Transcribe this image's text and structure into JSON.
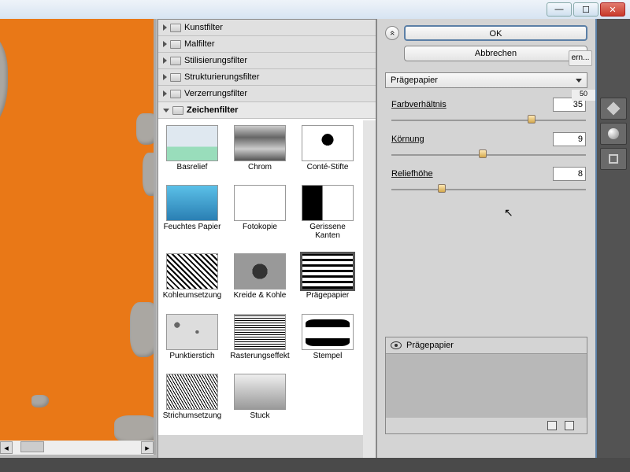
{
  "window": {
    "minimize": "—",
    "maximize": "☐",
    "close": "✕",
    "ern": "ern..."
  },
  "ruler": "50",
  "categories": [
    {
      "label": "Kunstfilter",
      "expanded": false
    },
    {
      "label": "Malfilter",
      "expanded": false
    },
    {
      "label": "Stilisierungsfilter",
      "expanded": false
    },
    {
      "label": "Strukturierungsfilter",
      "expanded": false
    },
    {
      "label": "Verzerrungsfilter",
      "expanded": false
    },
    {
      "label": "Zeichenfilter",
      "expanded": true
    }
  ],
  "filters": [
    {
      "label": "Basrelief",
      "art": "art-bas"
    },
    {
      "label": "Chrom",
      "art": "art-chr"
    },
    {
      "label": "Conté-Stifte",
      "art": "art-con"
    },
    {
      "label": "Feuchtes Papier",
      "art": "art-feu"
    },
    {
      "label": "Fotokopie",
      "art": "art-fot"
    },
    {
      "label": "Gerissene Kanten",
      "art": "art-ger"
    },
    {
      "label": "Kohleumsetzung",
      "art": "art-koh"
    },
    {
      "label": "Kreide & Kohle",
      "art": "art-kre"
    },
    {
      "label": "Prägepapier",
      "art": "art-pra",
      "selected": true
    },
    {
      "label": "Punktierstich",
      "art": "art-pun"
    },
    {
      "label": "Rasterungseffekt",
      "art": "art-ras"
    },
    {
      "label": "Stempel",
      "art": "art-ste"
    },
    {
      "label": "Strichumsetzung",
      "art": "art-str"
    },
    {
      "label": "Stuck",
      "art": "art-stu"
    }
  ],
  "buttons": {
    "ok": "OK",
    "cancel": "Abbrechen",
    "collapse": "«"
  },
  "selector": "Prägepapier",
  "params": [
    {
      "label": "Farbverhältnis",
      "value": "35",
      "pct": 70
    },
    {
      "label": "Körnung",
      "value": "9",
      "pct": 45
    },
    {
      "label": "Reliefhöhe",
      "value": "8",
      "pct": 24
    }
  ],
  "layer": {
    "name": "Prägepapier"
  }
}
